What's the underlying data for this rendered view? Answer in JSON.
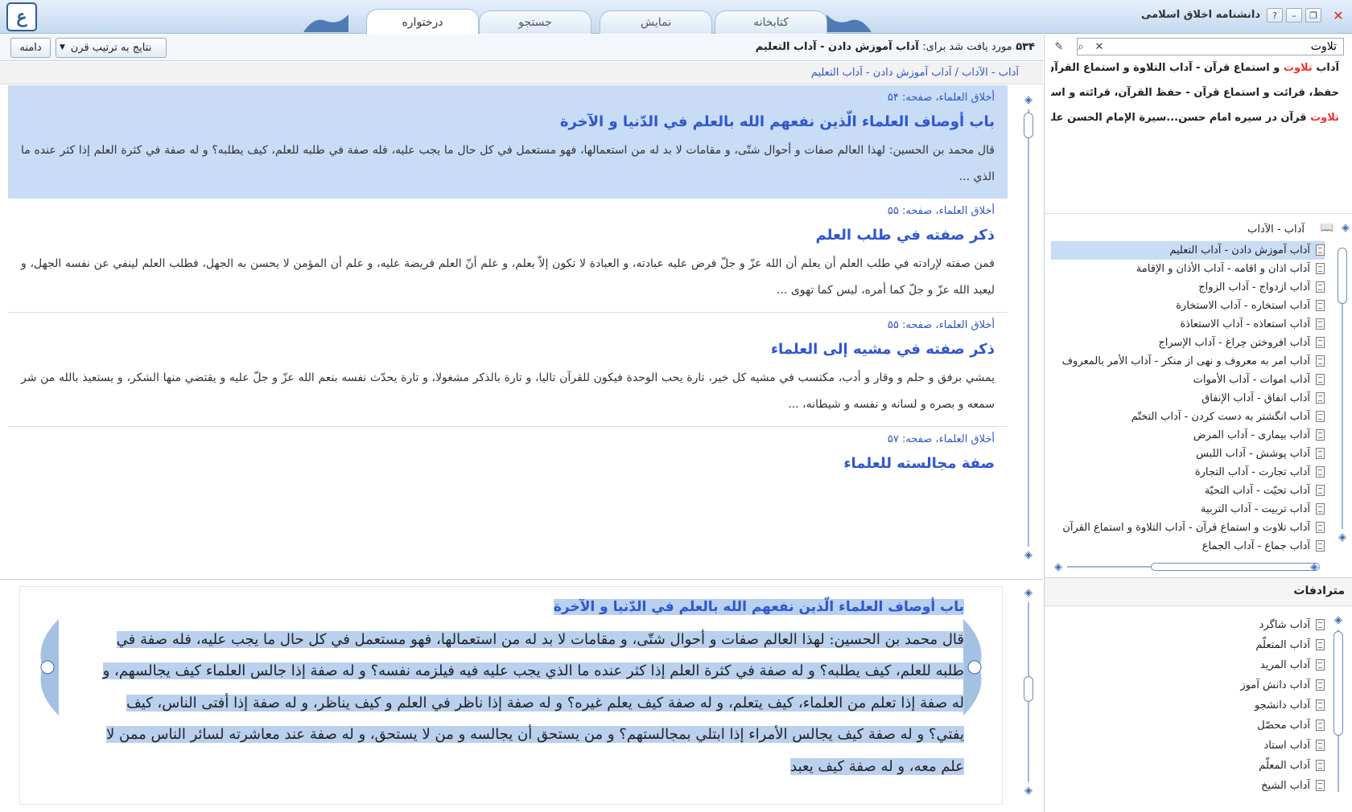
{
  "app": {
    "title": "دانشنامه اخلاق اسلامی",
    "logo_text": "ع",
    "help_icon": "question-icon",
    "minimize_icon": "minimize-icon",
    "restore_icon": "restore-icon",
    "close_icon": "close-icon"
  },
  "tabs": [
    {
      "label": "درختواره",
      "active": true
    },
    {
      "label": "جستجو",
      "active": false
    },
    {
      "label": "نمایش",
      "active": false
    },
    {
      "label": "کتابخانه",
      "active": false
    }
  ],
  "results_bar": {
    "count": "۵۳۴",
    "found_label": "مورد یافت شد برای:",
    "query": "آداب آموزش دادن - آداب التعليم",
    "sort_label": "نتایج به ترتیب قرن",
    "scope_label": "دامنه"
  },
  "breadcrumb": "آداب - الآداب / آداب آموزش دادن - آداب التعليم",
  "results": [
    {
      "source": "أخلاق العلماء، صفحه: ۵۴",
      "title": "باب أوصاف العلماء الّذين نفعهم الله بالعلم في الدّنيا و الآخرة",
      "text": "قال محمد بن الحسين: لهذا العالم صفات و أحوال شتّى، و مقامات لا بد له من استعمالها، فهو مستعمل في كل حال ما يجب عليه، فله صفة في طلبه للعلم، كيف يطلبه؟ و له صفة في كثرة العلم إذا كثر عنده ما الذي ...",
      "selected": true
    },
    {
      "source": "أخلاق العلماء، صفحه: ۵۵",
      "title": "ذكر صفته في طلب العلم",
      "text": "فمن صفته لإرادته في طلب العلم أن يعلم أن الله عزّ و جلّ فرض عليه عبادته، و العبادة لا تكون إلاّ بعلم، و علم أنّ العلم فريضة عليه، و علم أن المؤمن لا يحسن به الجهل، فطلب العلم لينفي عن نفسه الجهل، و ليعبد الله عزّ و جلّ كما أمره، ليس كما تهوى ...",
      "selected": false
    },
    {
      "source": "أخلاق العلماء، صفحه: ۵۵",
      "title": "ذكر صفته في مشيه إلى العلماء",
      "text": "يمشي برفق و حلم و وقار و أدب، مكتسب في مشيه كل خير، تارة يحب الوحدة فيكون للقرآن تاليا، و تارة بالذكر مشغولا، و تارة يحدّث نفسه بنعم الله عزّ و جلّ عليه و يقتضي منها الشكر، و يستعيذ بالله من شر سمعه و بصره و لسانه و نفسه و شيطانه، ...",
      "selected": false
    },
    {
      "source": "أخلاق العلماء، صفحه: ۵۷",
      "title": "صفة مجالسته للعلماء",
      "text": "",
      "selected": false
    }
  ],
  "detail": {
    "title": "باب أوصاف العلماء الّذين نفعهم الله بالعلم في الدّنيا و الآخرة",
    "body": "قال محمد بن الحسين: لهذا العالم صفات و أحوال شتّى، و مقامات لا بد له من استعمالها، فهو مستعمل في كل حال ما يجب عليه، فله صفة في طلبه للعلم، كيف يطلبه؟ و له صفة في كثرة العلم إذا كثر عنده ما الذي يجب عليه فيه فيلزمه نفسه؟ و له صفة إذا جالس العلماء كيف يجالسهم، و له صفة إذا تعلم من العلماء، كيف يتعلم، و له صفة كيف يعلم غيره؟ و له صفة إذا ناظر في العلم و كيف يناظر، و له صفة إذا أفتى الناس، كيف يفتي؟ و له صفة كيف يجالس الأمراء إذا ابتلي بمجالستهم؟ و من يستحق أن يجالسه و من لا يستحق، و له صفة عند معاشرته لسائر الناس ممن لا علم معه، و له صفة كيف يعبد"
  },
  "search": {
    "value": "تلاوت",
    "clear_icon": "close-icon",
    "search_icon": "search-icon",
    "options_icon": "wrench-icon"
  },
  "suggestions": [
    {
      "highlight": "تلاوت",
      "before": "آداب ",
      "after": " و استماع قرآن - آداب التلاوة و استماع القرآن"
    },
    {
      "highlight": "",
      "before": "حفظ، قرائت و استماع قرآن - حفظ القرآن، قرائته و استماعه",
      "after": ""
    },
    {
      "highlight": "تلاوت",
      "before": "",
      "after": " قرآن در سیره امام حسن...سيرة الإمام الحسن عليه‌السلام"
    }
  ],
  "tree": {
    "root": "آداب - الآداب",
    "items": [
      {
        "label": "آداب آموزش دادن  - آداب التعليم",
        "selected": true
      },
      {
        "label": "آداب اذان و اقامه - آداب الأذان و الإقامة",
        "selected": false
      },
      {
        "label": "آداب ازدواج  - آداب الزواج",
        "selected": false
      },
      {
        "label": "آداب استخاره - آداب الاستخارة",
        "selected": false
      },
      {
        "label": "آداب استعاذه - آداب الاستعاذة",
        "selected": false
      },
      {
        "label": "آداب افروختن چراغ - آداب الإسراج",
        "selected": false
      },
      {
        "label": "آداب امر به معروف و نهی از منکر - آداب الأمر بالمعروف",
        "selected": false
      },
      {
        "label": "آداب اموات - آداب الأموات",
        "selected": false
      },
      {
        "label": "آداب انفاق - آداب الإنفاق",
        "selected": false
      },
      {
        "label": "آداب انگشتر به دست کردن - آداب التختّم",
        "selected": false
      },
      {
        "label": "آداب بیماری - آداب المرض",
        "selected": false
      },
      {
        "label": "آداب پوشش - آداب اللبس",
        "selected": false
      },
      {
        "label": "آداب تجارت - آداب التجارة",
        "selected": false
      },
      {
        "label": "آداب تحیّت - آداب التحيّة",
        "selected": false
      },
      {
        "label": "آداب تربیت - آداب التربية",
        "selected": false
      },
      {
        "label": "آداب تلاوت و استماع قرآن - آداب التلاوة و استماع القرآن",
        "selected": false
      },
      {
        "label": "آداب جماع - آداب الجماع",
        "selected": false
      }
    ]
  },
  "synonyms": {
    "title": "مترادفات",
    "items": [
      "آداب شاگرد",
      "آداب المتعلّم",
      "آداب المريد",
      "آداب دانش آموز",
      "آداب دانشجو",
      "آداب محصّل",
      "آداب استاد",
      "آداب المعلّم",
      "آداب الشيخ"
    ]
  },
  "colors": {
    "accent": "#2f56cf",
    "selection": "#c8dcf6",
    "highlight": "#e33333",
    "titlebar": "#c4d9f0"
  }
}
